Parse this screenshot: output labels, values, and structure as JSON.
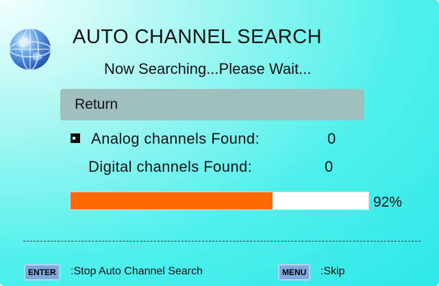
{
  "header": {
    "title": "AUTO CHANNEL SEARCH",
    "subtitle": "Now Searching...Please Wait...",
    "logo_icon": "globe-icon"
  },
  "menu": {
    "return_label": "Return",
    "highlight_color": "#9fbfbf"
  },
  "results": {
    "analog_label": "Analog channels Found:",
    "analog_count": "0",
    "analog_marker_icon": "selection-marker-icon",
    "digital_label": "Digital channels Found:",
    "digital_count": "0"
  },
  "progress": {
    "fraction": 0.92,
    "label": "92%",
    "fill_color": "#ff6a00"
  },
  "footer": {
    "enter_key": "ENTER",
    "enter_hint": ":Stop Auto Channel Search",
    "menu_key": "MENU",
    "menu_hint": ":Skip"
  },
  "colors": {
    "background": "#2ee8e8",
    "key_button": "#7fa9dd"
  }
}
